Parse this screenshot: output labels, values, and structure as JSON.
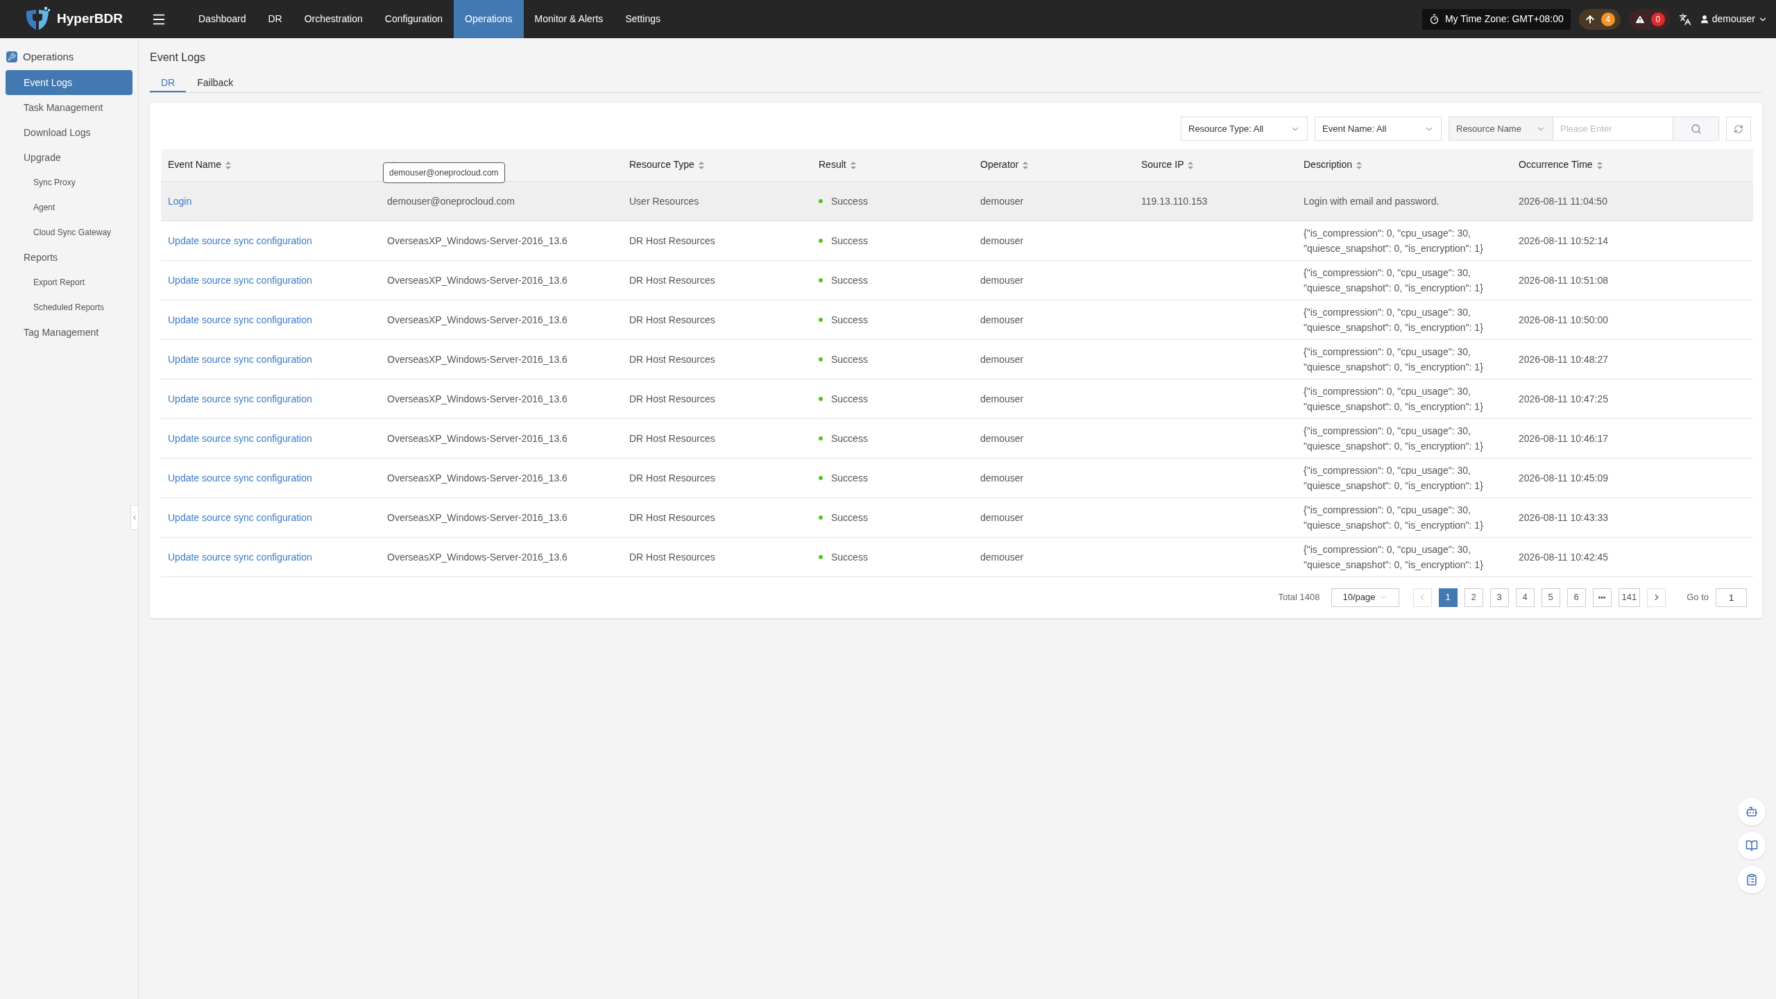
{
  "app": {
    "name": "HyperBDR"
  },
  "nav": [
    {
      "label": "Dashboard",
      "selected": false
    },
    {
      "label": "DR",
      "selected": false
    },
    {
      "label": "Orchestration",
      "selected": false
    },
    {
      "label": "Configuration",
      "selected": false
    },
    {
      "label": "Operations",
      "selected": true
    },
    {
      "label": "Monitor & Alerts",
      "selected": false
    },
    {
      "label": "Settings",
      "selected": false
    }
  ],
  "topbar": {
    "timezone": "My Time Zone: GMT+08:00",
    "upload_count": "4",
    "alert_count": "0",
    "user": "demouser"
  },
  "sidebar": {
    "title": "Operations",
    "items": [
      {
        "label": "Event Logs",
        "selected": true
      },
      {
        "label": "Task Management",
        "selected": false
      },
      {
        "label": "Download Logs",
        "selected": false
      },
      {
        "label": "Upgrade",
        "selected": false,
        "children": [
          {
            "label": "Sync Proxy",
            "selected": false
          },
          {
            "label": "Agent",
            "selected": false
          },
          {
            "label": "Cloud Sync Gateway",
            "selected": false
          }
        ]
      },
      {
        "label": "Reports",
        "selected": false,
        "children": [
          {
            "label": "Export Report",
            "selected": false
          },
          {
            "label": "Scheduled Reports",
            "selected": false
          }
        ]
      },
      {
        "label": "Tag Management",
        "selected": false
      }
    ]
  },
  "page": {
    "title": "Event Logs"
  },
  "tabs": [
    {
      "label": "DR",
      "selected": true
    },
    {
      "label": "Failback",
      "selected": false
    }
  ],
  "filters": {
    "resource_type": "Resource Type: All",
    "event_name": "Event Name: All",
    "search_scope": "Resource Name",
    "search": {
      "placeholder": "Please Enter"
    }
  },
  "table": {
    "columns": [
      {
        "label": "Event Name",
        "sortable": true
      },
      {
        "sortable": true,
        "tooltip": "demouser@oneprocloud.com"
      },
      {
        "label": "Resource Type",
        "sortable": true
      },
      {
        "label": "Result",
        "sortable": true
      },
      {
        "label": "Operator",
        "sortable": true
      },
      {
        "label": "Source IP",
        "sortable": true
      },
      {
        "label": "Description",
        "sortable": true
      },
      {
        "label": "Occurrence Time",
        "sortable": true
      }
    ],
    "rows": [
      {
        "hovered": true,
        "cells": [
          "Login",
          "demouser@oneprocloud.com",
          "User Resources",
          "Success",
          "demouser",
          "119.13.110.153",
          "Login with email and password.",
          "2026-08-11 11:04:50"
        ]
      },
      {
        "hovered": false,
        "cells": [
          "Update source sync configuration",
          "OverseasXP_Windows-Server-2016_13.6",
          "DR Host Resources",
          "Success",
          "demouser",
          null,
          "{\"is_compression\": 0, \"cpu_usage\": 30,\n\"quiesce_snapshot\": 0, \"is_encryption\": 1}",
          "2026-08-11 10:52:14"
        ]
      },
      {
        "hovered": false,
        "cells": [
          "Update source sync configuration",
          "OverseasXP_Windows-Server-2016_13.6",
          "DR Host Resources",
          "Success",
          "demouser",
          null,
          "{\"is_compression\": 0, \"cpu_usage\": 30,\n\"quiesce_snapshot\": 0, \"is_encryption\": 1}",
          "2026-08-11 10:51:08"
        ]
      },
      {
        "hovered": false,
        "cells": [
          "Update source sync configuration",
          "OverseasXP_Windows-Server-2016_13.6",
          "DR Host Resources",
          "Success",
          "demouser",
          null,
          "{\"is_compression\": 0, \"cpu_usage\": 30,\n\"quiesce_snapshot\": 0, \"is_encryption\": 1}",
          "2026-08-11 10:50:00"
        ]
      },
      {
        "hovered": false,
        "cells": [
          "Update source sync configuration",
          "OverseasXP_Windows-Server-2016_13.6",
          "DR Host Resources",
          "Success",
          "demouser",
          null,
          "{\"is_compression\": 0, \"cpu_usage\": 30,\n\"quiesce_snapshot\": 0, \"is_encryption\": 1}",
          "2026-08-11 10:48:27"
        ]
      },
      {
        "hovered": false,
        "cells": [
          "Update source sync configuration",
          "OverseasXP_Windows-Server-2016_13.6",
          "DR Host Resources",
          "Success",
          "demouser",
          null,
          "{\"is_compression\": 0, \"cpu_usage\": 30,\n\"quiesce_snapshot\": 0, \"is_encryption\": 1}",
          "2026-08-11 10:47:25"
        ]
      },
      {
        "hovered": false,
        "cells": [
          "Update source sync configuration",
          "OverseasXP_Windows-Server-2016_13.6",
          "DR Host Resources",
          "Success",
          "demouser",
          null,
          "{\"is_compression\": 0, \"cpu_usage\": 30,\n\"quiesce_snapshot\": 0, \"is_encryption\": 1}",
          "2026-08-11 10:46:17"
        ]
      },
      {
        "hovered": false,
        "cells": [
          "Update source sync configuration",
          "OverseasXP_Windows-Server-2016_13.6",
          "DR Host Resources",
          "Success",
          "demouser",
          null,
          "{\"is_compression\": 0, \"cpu_usage\": 30,\n\"quiesce_snapshot\": 0, \"is_encryption\": 1}",
          "2026-08-11 10:45:09"
        ]
      },
      {
        "hovered": false,
        "cells": [
          "Update source sync configuration",
          "OverseasXP_Windows-Server-2016_13.6",
          "DR Host Resources",
          "Success",
          "demouser",
          null,
          "{\"is_compression\": 0, \"cpu_usage\": 30,\n\"quiesce_snapshot\": 0, \"is_encryption\": 1}",
          "2026-08-11 10:43:33"
        ]
      },
      {
        "hovered": false,
        "cells": [
          "Update source sync configuration",
          "OverseasXP_Windows-Server-2016_13.6",
          "DR Host Resources",
          "Success",
          "demouser",
          null,
          "{\"is_compression\": 0, \"cpu_usage\": 30,\n\"quiesce_snapshot\": 0, \"is_encryption\": 1}",
          "2026-08-11 10:42:45"
        ]
      }
    ]
  },
  "pagination": {
    "total": "Total 1408",
    "page_size": "10/page",
    "pages": [
      {
        "kind": "page",
        "label": "1",
        "selected": true
      },
      {
        "kind": "page",
        "label": "2",
        "selected": false
      },
      {
        "kind": "page",
        "label": "3",
        "selected": false
      },
      {
        "kind": "page",
        "label": "4",
        "selected": false
      },
      {
        "kind": "page",
        "label": "5",
        "selected": false
      },
      {
        "kind": "page",
        "label": "6",
        "selected": false
      },
      {
        "kind": "more",
        "label": "•••",
        "selected": false
      },
      {
        "kind": "page",
        "label": "141",
        "selected": false
      }
    ],
    "goto_label": "Go to",
    "goto_value": "1"
  }
}
